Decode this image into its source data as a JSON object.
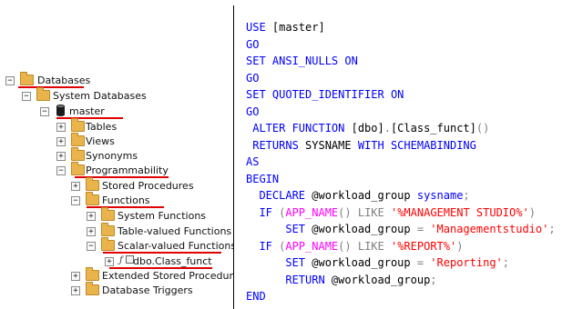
{
  "colors": {
    "keyword": "#0000ff",
    "string": "#ff0000",
    "function": "#ff00ff",
    "operator": "#808080",
    "text": "#000000",
    "annotation_underline": "#e00000",
    "folder": "#e9b44c"
  },
  "object_explorer": {
    "nodes": [
      {
        "label": "Databases",
        "toggle": "⊟",
        "icon": "folder-icon"
      },
      {
        "label": "System Databases",
        "toggle": "⊟",
        "icon": "folder-icon"
      },
      {
        "label": "master",
        "toggle": "⊟",
        "icon": "database-icon"
      },
      {
        "label": "Tables",
        "toggle": "⊞",
        "icon": "folder-icon"
      },
      {
        "label": "Views",
        "toggle": "⊞",
        "icon": "folder-icon"
      },
      {
        "label": "Synonyms",
        "toggle": "⊞",
        "icon": "folder-icon"
      },
      {
        "label": "Programmability",
        "toggle": "⊟",
        "icon": "folder-icon"
      },
      {
        "label": "Stored Procedures",
        "toggle": "⊞",
        "icon": "folder-icon"
      },
      {
        "label": "Functions",
        "toggle": "⊟",
        "icon": "folder-icon"
      },
      {
        "label": "System Functions",
        "toggle": "⊞",
        "icon": "folder-icon"
      },
      {
        "label": "Table-valued Functions",
        "toggle": "⊞",
        "icon": "folder-icon"
      },
      {
        "label": "Scalar-valued Functions",
        "toggle": "⊟",
        "icon": "folder-icon"
      },
      {
        "label": "dbo.Class_funct",
        "toggle": "⊞",
        "icon": "scalar-function-icon"
      },
      {
        "label": "Extended Stored Procedures",
        "toggle": "⊞",
        "icon": "folder-icon"
      },
      {
        "label": "Database Triggers",
        "toggle": "⊞",
        "icon": "folder-icon"
      }
    ]
  },
  "editor": {
    "lines": [
      [
        [
          "kw",
          "USE "
        ],
        [
          "tx",
          "[master]"
        ]
      ],
      [
        [
          "kw",
          "GO"
        ]
      ],
      [
        [
          "kw",
          "SET ANSI_NULLS ON"
        ]
      ],
      [
        [
          "kw",
          "GO"
        ]
      ],
      [
        [
          "kw",
          "SET QUOTED_IDENTIFIER ON"
        ]
      ],
      [
        [
          "kw",
          "GO"
        ]
      ],
      [
        [
          "kw",
          " ALTER FUNCTION "
        ],
        [
          "tx",
          "[dbo]"
        ],
        [
          "gy",
          "."
        ],
        [
          "tx",
          "[Class_funct]"
        ],
        [
          "gy",
          "()"
        ]
      ],
      [
        [
          "kw",
          " RETURNS "
        ],
        [
          "tx",
          "SYSNAME "
        ],
        [
          "kw",
          "WITH SCHEMABINDING"
        ]
      ],
      [
        [
          "kw",
          "AS"
        ]
      ],
      [
        [
          "kw",
          "BEGIN"
        ]
      ],
      [
        [
          "kw",
          "  DECLARE "
        ],
        [
          "tx",
          "@workload_group "
        ],
        [
          "kw",
          "sysname"
        ],
        [
          "gy",
          ";"
        ]
      ],
      [
        [
          "kw",
          "  IF "
        ],
        [
          "gy",
          "("
        ],
        [
          "fn",
          "APP_NAME"
        ],
        [
          "gy",
          "() "
        ],
        [
          "gy",
          "LIKE "
        ],
        [
          "st",
          "'%MANAGEMENT STUDIO%'"
        ],
        [
          "gy",
          ")"
        ]
      ],
      [
        [
          "kw",
          "      SET "
        ],
        [
          "tx",
          "@workload_group "
        ],
        [
          "gy",
          "= "
        ],
        [
          "st",
          "'Managementstudio'"
        ],
        [
          "gy",
          ";"
        ]
      ],
      [
        [
          "kw",
          "  IF "
        ],
        [
          "gy",
          "("
        ],
        [
          "fn",
          "APP_NAME"
        ],
        [
          "gy",
          "() "
        ],
        [
          "gy",
          "LIKE "
        ],
        [
          "st",
          "'%REPORT%'"
        ],
        [
          "gy",
          ")"
        ]
      ],
      [
        [
          "kw",
          "      SET "
        ],
        [
          "tx",
          "@workload_group "
        ],
        [
          "gy",
          "= "
        ],
        [
          "st",
          "'Reporting'"
        ],
        [
          "gy",
          ";"
        ]
      ],
      [
        [
          "kw",
          "      RETURN "
        ],
        [
          "tx",
          "@workload_group"
        ],
        [
          "gy",
          ";"
        ]
      ],
      [
        [
          "kw",
          "END"
        ]
      ]
    ]
  }
}
